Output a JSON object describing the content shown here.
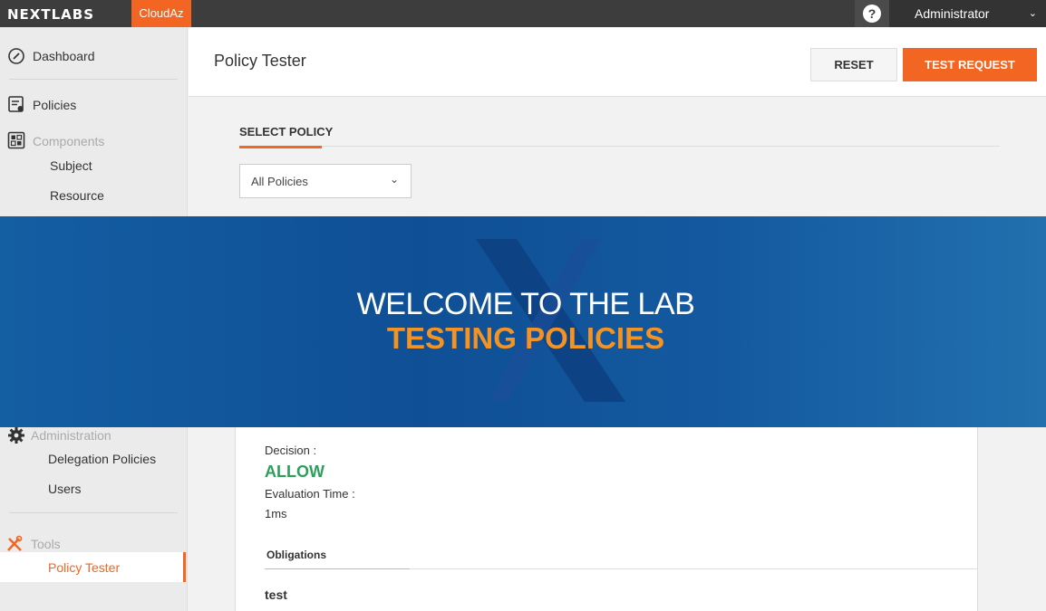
{
  "topbar": {
    "logo": "NEXTLABS",
    "product": "CloudAz",
    "help_symbol": "?",
    "user": "Administrator"
  },
  "sidebar": {
    "dashboard": "Dashboard",
    "policies": "Policies",
    "components": "Components",
    "subject": "Subject",
    "resource": "Resource",
    "administration": "Administration",
    "delegation_policies": "Delegation Policies",
    "users": "Users",
    "tools": "Tools",
    "policy_tester": "Policy Tester"
  },
  "header": {
    "title": "Policy Tester",
    "reset_label": "RESET",
    "test_label": "TEST REQUEST"
  },
  "main": {
    "tab_label": "SELECT POLICY",
    "select_value": "All Policies"
  },
  "banner": {
    "title": "WELCOME TO THE LAB",
    "subtitle": "TESTING POLICIES"
  },
  "result": {
    "decision_label": "Decision :",
    "decision_value": "ALLOW",
    "eval_label": "Evaluation Time :",
    "eval_value": "1ms",
    "obligations_label": "Obligations",
    "obligation_value": "test"
  },
  "colors": {
    "accent": "#f26522",
    "allow": "#2e9e5b",
    "banner_blue": "#145ea3"
  }
}
